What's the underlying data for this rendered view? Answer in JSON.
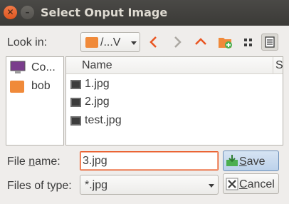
{
  "window": {
    "title": "Select Onput Image"
  },
  "look_in": {
    "label": "Look in:",
    "path": "/...V"
  },
  "sidebar": {
    "items": [
      {
        "label": "Co..."
      },
      {
        "label": "bob"
      }
    ]
  },
  "file_list": {
    "columns": [
      "Name",
      "S"
    ],
    "rows": [
      {
        "name": "1.jpg"
      },
      {
        "name": "2.jpg"
      },
      {
        "name": "test.jpg"
      }
    ]
  },
  "file_name": {
    "label_pre": "File ",
    "label_mnemonic": "n",
    "label_post": "ame:",
    "value": "3.jpg"
  },
  "file_type": {
    "label": "Files of type:",
    "value": "*.jpg"
  },
  "buttons": {
    "save_mnemonic": "S",
    "save_rest": "ave",
    "cancel_mnemonic": "C",
    "cancel_rest": "ancel"
  },
  "colors": {
    "accent": "#e95420",
    "folder": "#f08a3a",
    "titlebar": "#3b3a37"
  }
}
